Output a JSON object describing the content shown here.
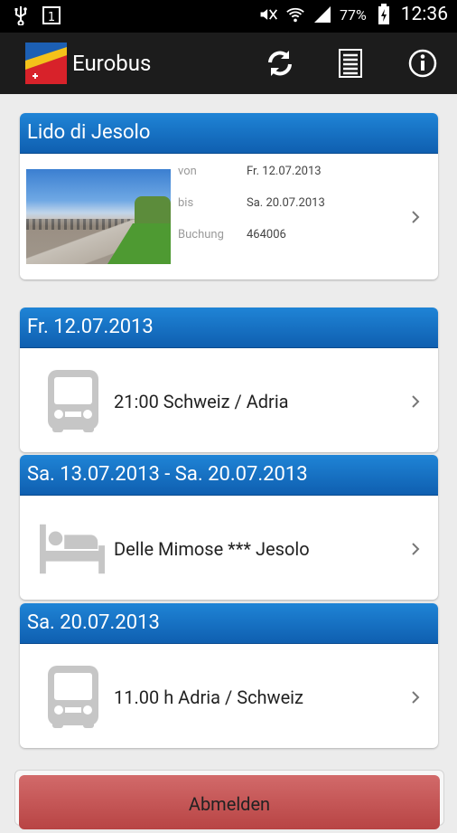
{
  "status_bar": {
    "time": "12:36",
    "battery_percent": "77%",
    "icons": [
      "usb-icon",
      "notification-box-icon",
      "mute-icon",
      "wifi-icon",
      "signal-icon",
      "battery-charging-icon"
    ]
  },
  "action_bar": {
    "title": "Eurobus",
    "actions": [
      "refresh-icon",
      "list-icon",
      "info-icon"
    ]
  },
  "trip": {
    "destination": "Lido di Jesolo",
    "details": [
      {
        "label": "von",
        "value": "Fr. 12.07.2013"
      },
      {
        "label": "bis",
        "value": "Sa. 20.07.2013"
      },
      {
        "label": "Buchung",
        "value": "464006"
      }
    ]
  },
  "itinerary": [
    {
      "date": "Fr. 12.07.2013",
      "icon": "bus-icon",
      "text": "21:00 Schweiz / Adria"
    },
    {
      "date": "Sa. 13.07.2013 - Sa. 20.07.2013",
      "icon": "bed-icon",
      "text": "Delle Mimose *** Jesolo"
    },
    {
      "date": "Sa. 20.07.2013",
      "icon": "bus-icon",
      "text": "11.00 h Adria / Schweiz"
    }
  ],
  "logout_button_label": "Abmelden",
  "colors": {
    "header_blue": "#1570c4",
    "action_bar": "#1c1c1c",
    "logout_red": "#c65757",
    "background": "#ececec"
  }
}
